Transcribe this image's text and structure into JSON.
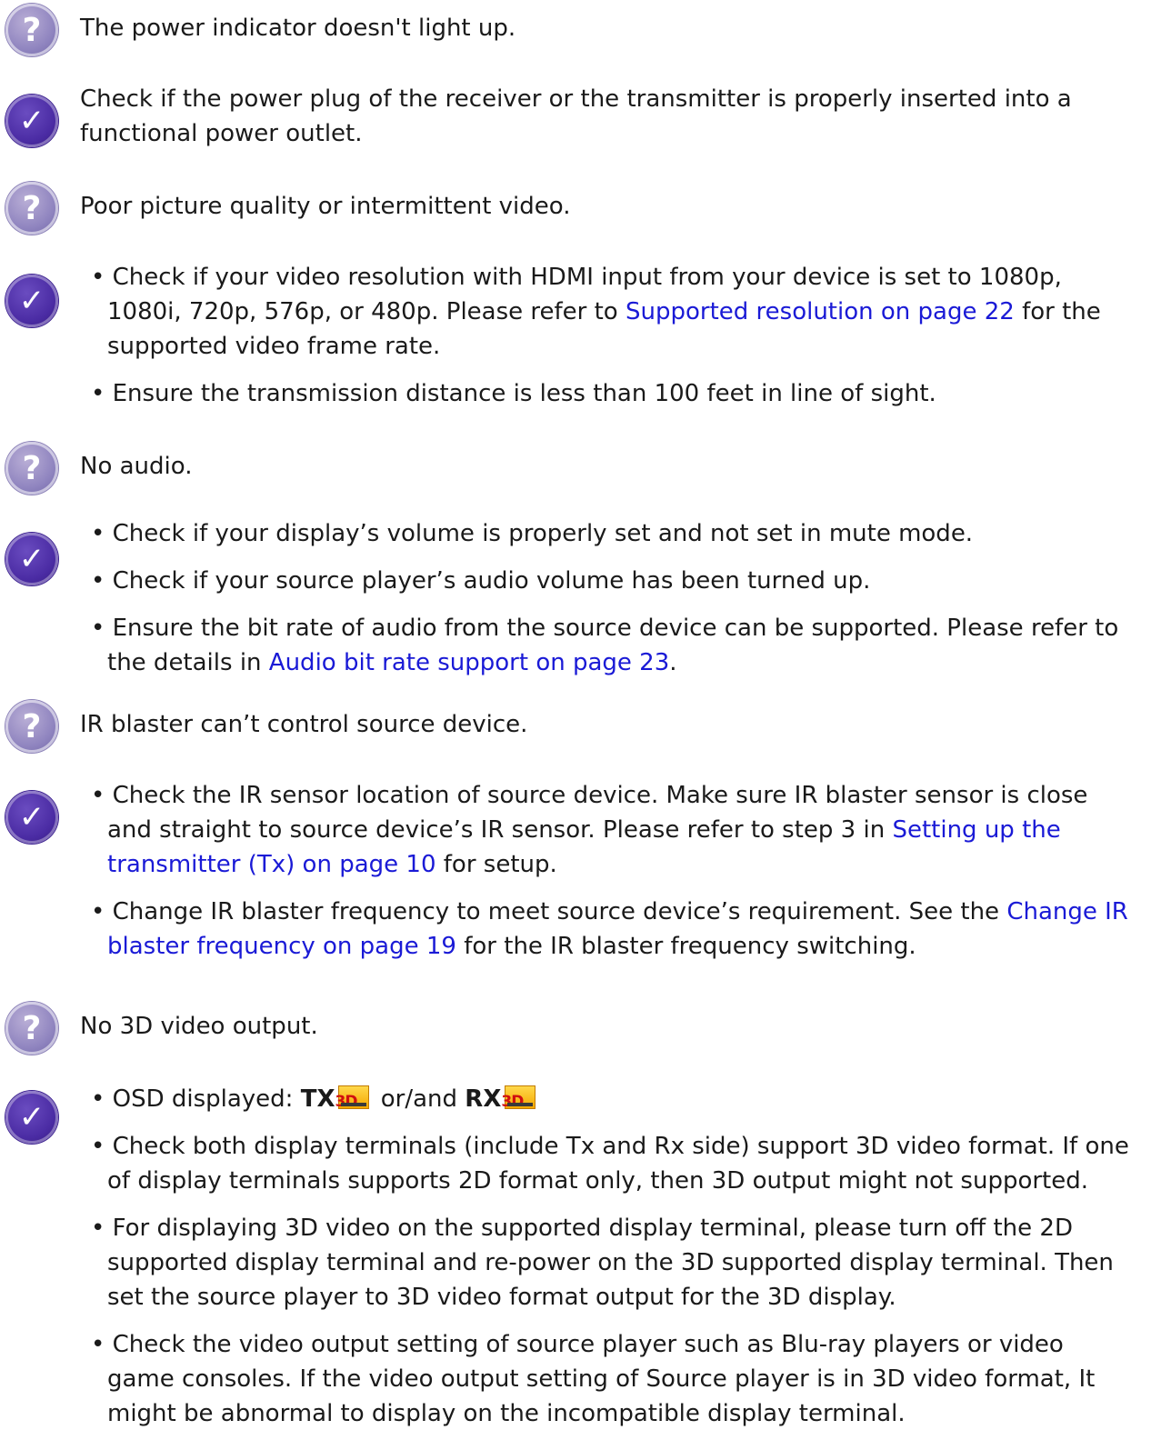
{
  "items": [
    {
      "question": "The power indicator doesn't light up.",
      "answer": "Check if the power plug of the receiver or the transmitter is properly inserted into a functional power outlet."
    },
    {
      "question": "Poor picture quality or intermittent video.",
      "bullets": [
        {
          "pre": "• Check if your video resolution with HDMI input from your device is set to 1080p, 1080i, 720p, 576p, or 480p. Please refer to ",
          "link": "Supported resolution on page 22",
          "post": " for the supported video frame rate."
        },
        {
          "pre": "• Ensure the transmission distance is less than 100 feet in line of sight."
        }
      ]
    },
    {
      "question": "No audio.",
      "bullets": [
        {
          "pre": "• Check if your display’s volume is properly set and not set in mute mode."
        },
        {
          "pre": "• Check if your source player’s audio volume has been turned up."
        },
        {
          "pre": "• Ensure the bit rate of audio from the source device can be supported. Please refer to the details in ",
          "link": "Audio bit rate support on page 23",
          "post": "."
        }
      ]
    },
    {
      "question": "IR blaster can’t control source device.",
      "bullets": [
        {
          "pre": "• Check the IR sensor location of source device. Make sure IR blaster sensor is close and straight to source device’s IR sensor. Please refer to step 3 in ",
          "link": "Setting up the transmitter (Tx) on page 10",
          "post": " for setup."
        },
        {
          "pre": "• Change IR blaster frequency to meet source device’s requirement. See the ",
          "link": "Change IR blaster frequency on page 19",
          "post": " for the IR blaster frequency switching."
        }
      ]
    },
    {
      "question": "No 3D video output.",
      "osd": {
        "pre": "• OSD displayed: ",
        "tx": "TX",
        "mid": " or/and ",
        "rx": "RX",
        "badge": "3D"
      },
      "bullets": [
        {
          "pre": "• Check both display terminals (include Tx and Rx side) support 3D video format. If one of display terminals supports 2D format only, then 3D output might not supported."
        },
        {
          "pre": "• For displaying 3D video on the supported display terminal, please turn off the 2D supported display terminal and re-power on the 3D supported display terminal. Then set the source player to 3D video format output for the 3D display."
        },
        {
          "pre": "• Check the video output setting of source player such as Blu-ray players or video game consoles. If the video output setting of Source player is in 3D video format, It might be abnormal to display on the incompatible display terminal."
        }
      ]
    }
  ],
  "icons": {
    "question_glyph": "?",
    "check_glyph": "✓"
  }
}
